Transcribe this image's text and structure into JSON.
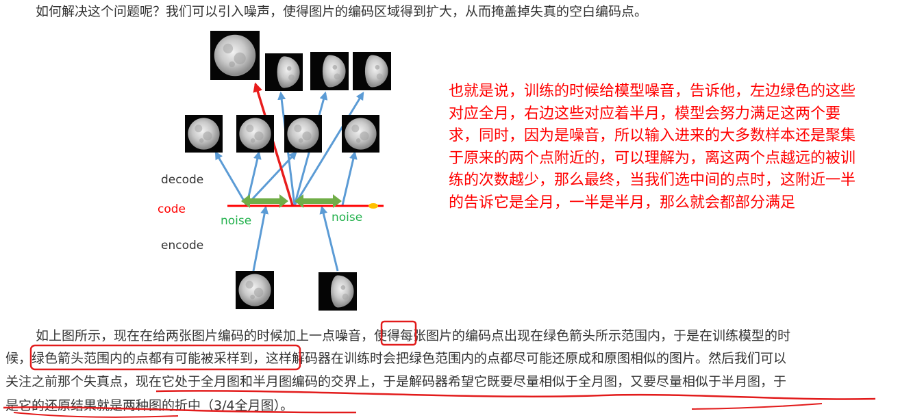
{
  "intro_text": "如何解决这个问题呢？我们可以引入噪声，使得图片的编码区域得到扩大，从而掩盖掉失真的空白编码点。",
  "figure": {
    "labels": {
      "decode": "decode",
      "code": "code",
      "encode": "encode",
      "noise_left": "noise",
      "noise_right": "noise"
    },
    "colors": {
      "arrow_blue": "#5b9bd5",
      "arrow_red": "#e81c1c",
      "code_line": "#ff0000",
      "noise_arrow": "#70ad47",
      "marker": "#ffc000"
    },
    "images": [
      "full-moon",
      "half-moon",
      "half-moon",
      "half-moon",
      "full-moon",
      "full-moon",
      "full-moon",
      "full-moon",
      "full-moon",
      "half-moon"
    ]
  },
  "note_lines": [
    "也就是说，训练的时候给模型噪音，告诉他，左边绿色的这些",
    "对应全月，右边这些对应着半月，模型会努力满足这两个要",
    "求，同时，因为是噪音，所以输入进来的大多数样本还是聚集",
    "于原来的两个点附近的，可以理解为，离这两个点越远的被训",
    "练的次数越少，那么最终，当我们选中间的点时，这附近一半",
    "的告诉它是全月，一半是半月，那么就会都部分满足"
  ],
  "body_lines": {
    "line1_a": "如上图所示，现在在给两张图片编码的时候加上一点",
    "line1_b": "噪音",
    "line1_c": "，使得每张图片的编码点出现在绿色箭头所示范围内，于是在训练模型的时",
    "line2_a": "候，",
    "line2_b": "绿色箭头范围内的点都有可能被采样到",
    "line2_c": "，这样解码器在训练时会把绿色范围内的点都尽可能还原成和原图相似的图片。然后我们可以",
    "line3": "关注之前那个失真点，现在它处于全月图和半月图编码的交界上，于是解码器希望它既要尽量相似于全月图，又要尽量相似于半月图，于",
    "line4": "是它的还原结果就是两种图的折中（3/4全月图）。"
  }
}
